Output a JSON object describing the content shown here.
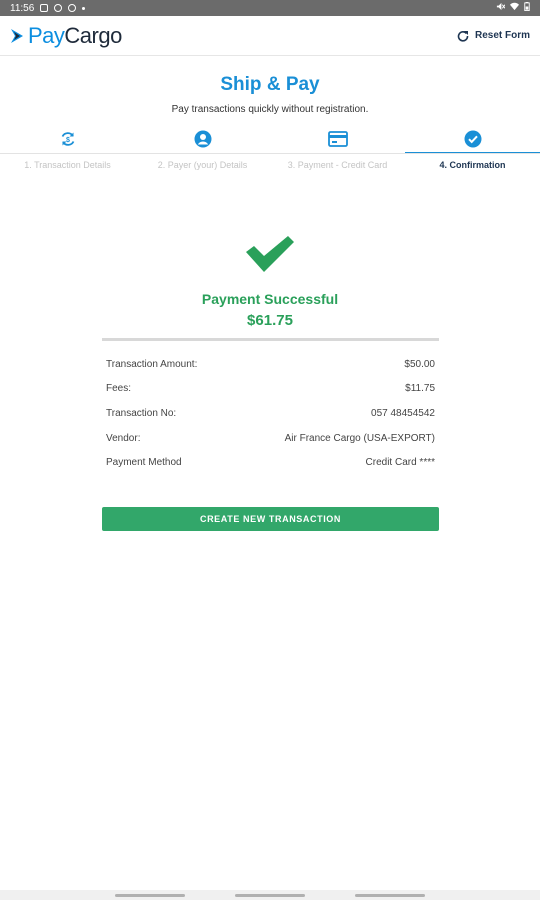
{
  "status_bar": {
    "time": "11:56"
  },
  "header": {
    "logo_pay": "Pay",
    "logo_cargo": "Cargo",
    "reset_label": "Reset Form"
  },
  "page": {
    "title": "Ship & Pay",
    "subtitle": "Pay transactions quickly without registration."
  },
  "steps": [
    {
      "label": "1. Transaction Details",
      "icon": "sync-icon",
      "active": false
    },
    {
      "label": "2. Payer (your) Details",
      "icon": "user-icon",
      "active": false
    },
    {
      "label": "3. Payment - Credit Card",
      "icon": "credit-card-icon",
      "active": false
    },
    {
      "label": "4. Confirmation",
      "icon": "check-circle-icon",
      "active": true
    }
  ],
  "result": {
    "title": "Payment Successful",
    "amount": "$61.75"
  },
  "details": [
    {
      "label": "Transaction Amount:",
      "value": "$50.00"
    },
    {
      "label": "Fees:",
      "value": "$11.75"
    },
    {
      "label": "Transaction No:",
      "value": "057 48454542"
    },
    {
      "label": "Vendor:",
      "value": "Air France Cargo (USA-EXPORT)"
    },
    {
      "label": "Payment Method",
      "value": "Credit Card ****"
    }
  ],
  "cta_label": "CREATE NEW TRANSACTION",
  "colors": {
    "brand_blue": "#1a8fd6",
    "success_green": "#2aa05a",
    "button_green": "#32a76a",
    "navy": "#1e3552"
  }
}
